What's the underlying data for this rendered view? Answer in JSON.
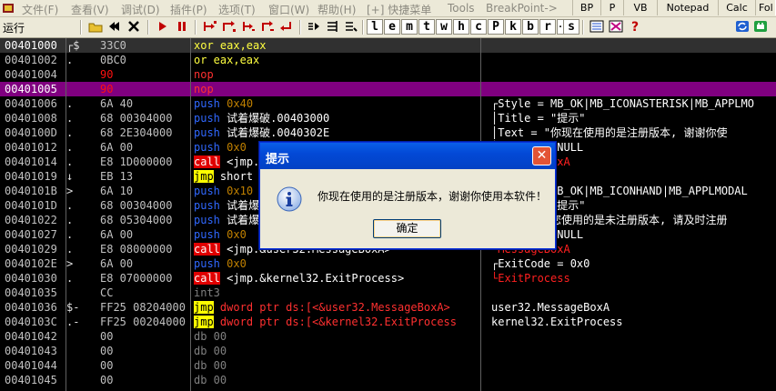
{
  "menu": {
    "items": [
      "文件(F)",
      "查看(V)",
      "调试(D)",
      "插件(P)",
      "选项(T)",
      "窗口(W)",
      "帮助(H)",
      "[+] 快捷菜单",
      "Tools",
      "BreakPoint->"
    ],
    "right_buttons": [
      "BP",
      "P",
      "VB",
      "Notepad",
      "Calc",
      "Fol"
    ]
  },
  "toolbar": {
    "status": "运行",
    "letters": [
      "l",
      "e",
      "m",
      "t",
      "w",
      "h",
      "c",
      "P",
      "k",
      "b",
      "r",
      "...",
      "s"
    ],
    "help": "?"
  },
  "rows": [
    {
      "addr": "00401000",
      "mark": "┌$",
      "hex": "33C0",
      "asm": "xor eax,eax",
      "comment": ""
    },
    {
      "addr": "00401002",
      "mark": ".",
      "hex": "0BC0",
      "asm": "or eax,eax",
      "comment": ""
    },
    {
      "addr": "00401004",
      "mark": "",
      "hex": "90",
      "asm": "nop",
      "comment": ""
    },
    {
      "addr": "00401005",
      "mark": "",
      "hex": "90",
      "asm": "nop",
      "comment": ""
    },
    {
      "addr": "00401006",
      "mark": ".",
      "hex": "6A 40",
      "asm_op": "push",
      "asm_arg": "0x40",
      "comment": "┌Style = MB_OK|MB_ICONASTERISK|MB_APPLMO"
    },
    {
      "addr": "00401008",
      "mark": ".",
      "hex": "68 00304000",
      "asm_op": "push",
      "asm_arg": "试着爆破.00403000",
      "comment": "│Title = \"提示\""
    },
    {
      "addr": "0040100D",
      "mark": ".",
      "hex": "68 2E304000",
      "asm_op": "push",
      "asm_arg": "试着爆破.0040302E",
      "comment": "│Text = \"你现在使用的是注册版本, 谢谢你使"
    },
    {
      "addr": "00401012",
      "mark": ".",
      "hex": "6A 00",
      "asm_op": "push",
      "asm_arg": "0x0",
      "comment": "│hOwner = NULL"
    },
    {
      "addr": "00401014",
      "mark": ".",
      "hex": "E8 1D000000",
      "asm_op": "call",
      "asm_arg": "<jmp.&user32.MessageBoxA>",
      "comment": "└MessageBoxA"
    },
    {
      "addr": "00401019",
      "mark": "↓",
      "hex": "EB 13",
      "asm_op": "jmp",
      "asm_arg": "short 试着爆破.0040102E",
      "comment": ""
    },
    {
      "addr": "0040101B",
      "mark": ">",
      "hex": "6A 10",
      "asm_op": "push",
      "asm_arg": "0x10",
      "comment": "┌Style = MB_OK|MB_ICONHAND|MB_APPLMODAL"
    },
    {
      "addr": "0040101D",
      "mark": ".",
      "hex": "68 00304000",
      "asm_op": "push",
      "asm_arg": "试着爆破.00403000",
      "comment": "│Title = \"提示\""
    },
    {
      "addr": "00401022",
      "mark": ".",
      "hex": "68 05304000",
      "asm_op": "push",
      "asm_arg": "试着爆破.00403005",
      "comment": "│Text = \"您使用的是未注册版本, 请及时注册"
    },
    {
      "addr": "00401027",
      "mark": ".",
      "hex": "6A 00",
      "asm_op": "push",
      "asm_arg": "0x0",
      "comment": "│hOwner = NULL"
    },
    {
      "addr": "00401029",
      "mark": ".",
      "hex": "E8 08000000",
      "asm_op": "call",
      "asm_arg": "<jmp.&user32.MessageBoxA>",
      "comment": "└MessageBoxA"
    },
    {
      "addr": "0040102E",
      "mark": ">",
      "hex": "6A 00",
      "asm_op": "push",
      "asm_arg": "0x0",
      "comment": "┌ExitCode = 0x0"
    },
    {
      "addr": "00401030",
      "mark": ".",
      "hex": "E8 07000000",
      "asm_op": "call",
      "asm_arg": "<jmp.&kernel32.ExitProcess>",
      "comment": "└ExitProcess"
    },
    {
      "addr": "00401035",
      "mark": "",
      "hex": "CC",
      "asm": "int3",
      "comment": ""
    },
    {
      "addr": "00401036",
      "mark": "$-",
      "hex": "FF25 08204000",
      "asm_op": "jmp",
      "asm_arg": "dword ptr ds:[<&user32.MessageBoxA>",
      "comment": "user32.MessageBoxA"
    },
    {
      "addr": "0040103C",
      "mark": ".-",
      "hex": "FF25 00204000",
      "asm_op": "jmp",
      "asm_arg": "dword ptr ds:[<&kernel32.ExitProcess",
      "comment": "kernel32.ExitProcess"
    },
    {
      "addr": "00401042",
      "mark": "",
      "hex": "00",
      "asm": "db 00",
      "comment": ""
    },
    {
      "addr": "00401043",
      "mark": "",
      "hex": "00",
      "asm": "db 00",
      "comment": ""
    },
    {
      "addr": "00401044",
      "mark": "",
      "hex": "00",
      "asm": "db 00",
      "comment": ""
    },
    {
      "addr": "00401045",
      "mark": "",
      "hex": "00",
      "asm": "db 00",
      "comment": ""
    }
  ],
  "dialog": {
    "title": "提示",
    "message": "你现在使用的是注册版本，谢谢你使用本软件！",
    "ok_label": "确定",
    "close_glyph": "✕"
  }
}
